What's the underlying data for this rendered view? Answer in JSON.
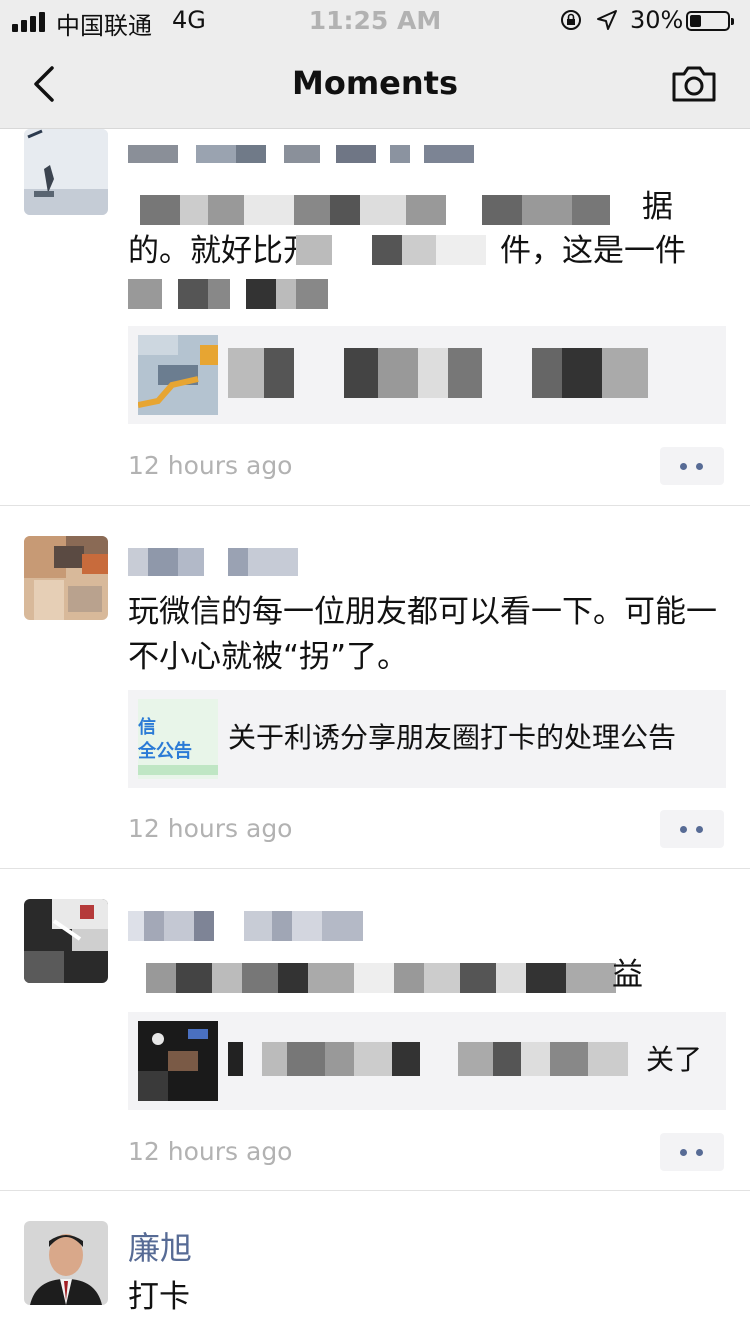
{
  "status_bar": {
    "carrier": "中国联通",
    "network": "4G",
    "time": "11:25 AM",
    "battery": "30%"
  },
  "nav": {
    "title": "Moments"
  },
  "posts": [
    {
      "visible_text_line1": "据",
      "visible_text_line2": "的。就好比开弓",
      "visible_text_line2b": "件，这是一件",
      "time": "12 hours ago"
    },
    {
      "text": "玩微信的每一位朋友都可以看一下。可能一不小心就被“拐”了。",
      "link_title": "关于利诱分享朋友圈打卡的处理公告",
      "thumb_line1": "信",
      "thumb_line2": "全公告",
      "time": "12 hours ago"
    },
    {
      "text_tail": "益",
      "link_tail": "关了",
      "time": "12 hours ago"
    },
    {
      "name": "廉旭",
      "text": "打卡"
    }
  ],
  "colors": {
    "name_blue": "#576b95",
    "bar_bg": "#ededed",
    "link_bg": "#f3f3f5",
    "time_gray": "#b2b2b2"
  },
  "icons": [
    "signal-icon",
    "orientation-lock-icon",
    "location-icon",
    "battery-icon",
    "back-chevron-icon",
    "camera-icon",
    "more-dots-icon"
  ]
}
